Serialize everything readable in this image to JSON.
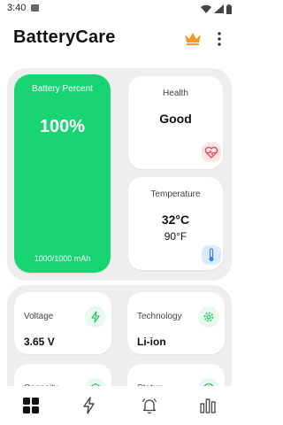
{
  "status_bar": {
    "time": "3:40",
    "icons": [
      "photo-icon",
      "wifi-icon",
      "signal-icon",
      "battery-icon"
    ]
  },
  "app_bar": {
    "title": "BatteryCare",
    "icons": [
      "crown-icon",
      "more-vert-icon"
    ],
    "crown_color": "#f29a1f"
  },
  "battery": {
    "title": "Battery Percent",
    "value": "100%",
    "capacity": "1000/1000 mAh",
    "color": "#18d473"
  },
  "health": {
    "title": "Health",
    "value": "Good",
    "icon": "heart-pulse-icon"
  },
  "temperature": {
    "title": "Temperature",
    "celsius": "32°C",
    "fahrenheit": "90°F",
    "icon": "thermometer-icon"
  },
  "stats": [
    {
      "label": "Voltage",
      "value": "3.65 V",
      "icon": "bolt-icon"
    },
    {
      "label": "Technology",
      "value": "Li-ion",
      "icon": "gear-icon"
    },
    {
      "label": "Capacity",
      "value": "",
      "icon": "cube-icon"
    },
    {
      "label": "Status",
      "value": "",
      "icon": "info-icon"
    }
  ],
  "bottom_nav": {
    "items": [
      "dashboard-icon",
      "charge-icon",
      "alarm-icon",
      "stats-icon"
    ],
    "active": "dashboard-icon"
  },
  "colors": {
    "accent_green": "#18d473",
    "icon_green": "#22c55e",
    "panel_bg": "#eeeeee",
    "health_icon_bg": "#ffe4e6",
    "temp_icon_bg": "#dbeafe"
  }
}
